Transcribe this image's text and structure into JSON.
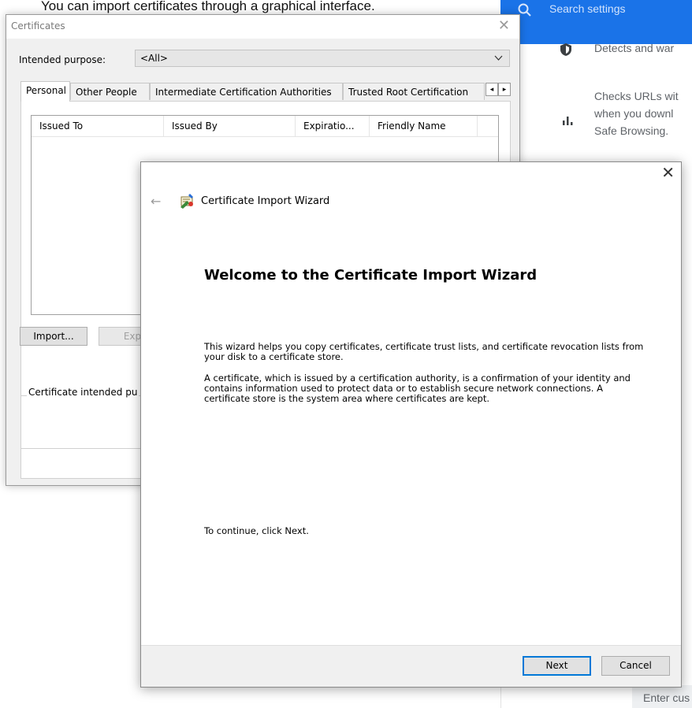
{
  "top_caption": "You can import certificates through a graphical interface.",
  "browser_settings": {
    "search_placeholder": "Search settings",
    "rows": [
      "Detects and war",
      "Checks URLs wit",
      "when you downl",
      "Safe Browsing."
    ],
    "footer_input": "Enter cus",
    "icons": [
      "shield-icon",
      "bar-chart-icon",
      "search-icon"
    ]
  },
  "certificates_dialog": {
    "title": "Certificates",
    "purpose_label": "Intended purpose:",
    "purpose_value": "<All>",
    "tabs": [
      "Personal",
      "Other People",
      "Intermediate Certification Authorities",
      "Trusted Root Certification"
    ],
    "columns": [
      "Issued To",
      "Issued By",
      "Expiratio...",
      "Friendly Name"
    ],
    "buttons": {
      "import": "Import...",
      "export": "Exp"
    },
    "purposes_label": "Certificate intended pu"
  },
  "import_wizard": {
    "window_title": "Certificate Import Wizard",
    "heading": "Welcome to the Certificate Import Wizard",
    "paragraph1": "This wizard helps you copy certificates, certificate trust lists, and certificate revocation lists from your disk to a certificate store.",
    "paragraph2": "A certificate, which is issued by a certification authority, is a confirmation of your identity and contains information used to protect data or to establish secure network connections. A certificate store is the system area where certificates are kept.",
    "continue_text": "To continue, click Next.",
    "next_label": "Next",
    "cancel_label": "Cancel"
  }
}
